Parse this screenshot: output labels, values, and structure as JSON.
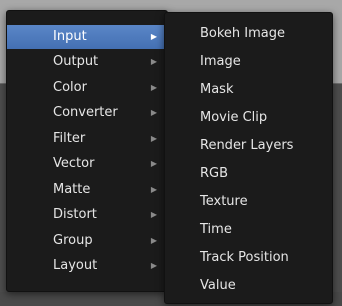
{
  "left_menu": {
    "items": [
      {
        "label": "Input",
        "arrow": "▶",
        "active": true
      },
      {
        "label": "Output",
        "arrow": "▶"
      },
      {
        "label": "Color",
        "arrow": "▶"
      },
      {
        "label": "Converter",
        "arrow": "▶"
      },
      {
        "label": "Filter",
        "arrow": "▶"
      },
      {
        "label": "Vector",
        "arrow": "▶"
      },
      {
        "label": "Matte",
        "arrow": "▶"
      },
      {
        "label": "Distort",
        "arrow": "▶"
      },
      {
        "label": "Group",
        "arrow": "▶"
      },
      {
        "label": "Layout",
        "arrow": "▶"
      }
    ]
  },
  "right_menu": {
    "items": [
      {
        "label": "Bokeh Image"
      },
      {
        "label": "Image"
      },
      {
        "label": "Mask"
      },
      {
        "label": "Movie Clip"
      },
      {
        "label": "Render Layers"
      },
      {
        "label": "RGB"
      },
      {
        "label": "Texture"
      },
      {
        "label": "Time"
      },
      {
        "label": "Track Position"
      },
      {
        "label": "Value"
      }
    ]
  },
  "colors": {
    "menu_bg": "#1b1b1b",
    "highlight": "#5a86c7",
    "text": "#e6e6e6",
    "background_top": "#a8a8a8",
    "background_main": "#4d4d4d"
  }
}
